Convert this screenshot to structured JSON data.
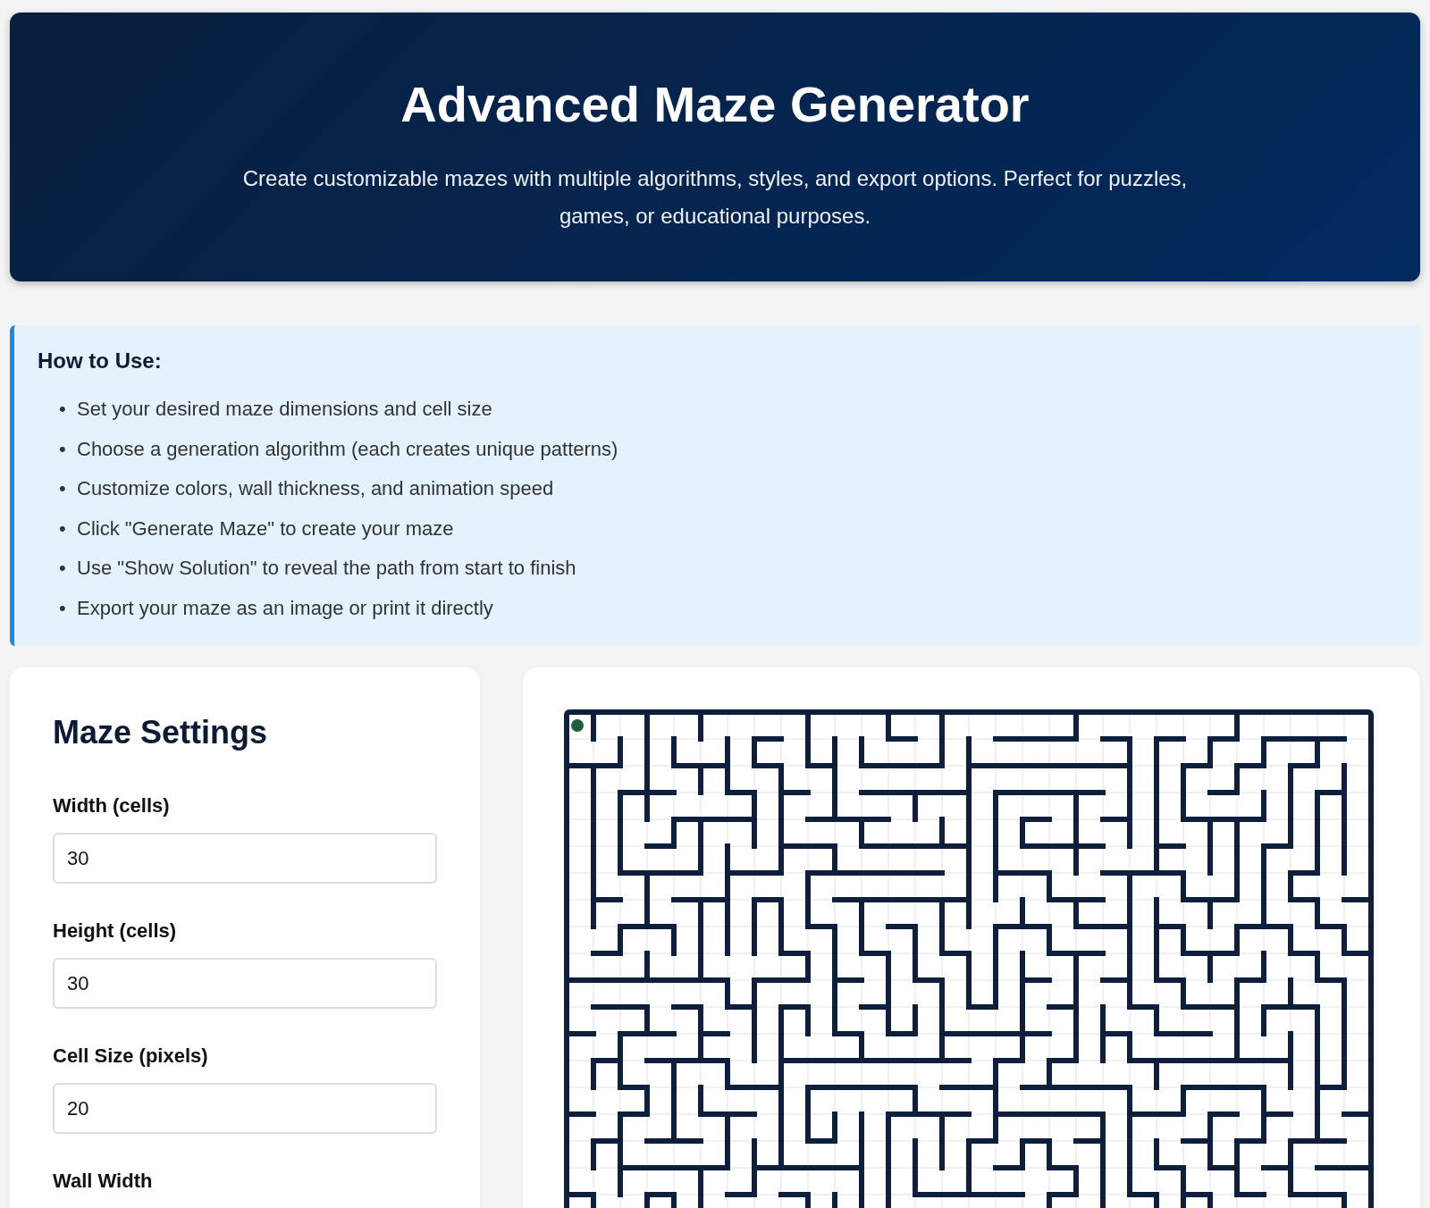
{
  "header": {
    "title": "Advanced Maze Generator",
    "subtitle": "Create customizable mazes with multiple algorithms, styles, and export options. Perfect for puzzles, games, or educational purposes."
  },
  "instructions": {
    "heading": "How to Use:",
    "items": [
      {
        "marker": "•",
        "text": "Set your desired maze dimensions and cell size"
      },
      {
        "marker": "•",
        "text": "Choose a generation algorithm (each creates unique patterns)"
      },
      {
        "marker": "•",
        "text": "Customize colors, wall thickness, and animation speed"
      },
      {
        "marker": "•",
        "text": "Click \"Generate Maze\" to create your maze"
      },
      {
        "marker": "•",
        "text": "Use \"Show Solution\" to reveal the path from start to finish"
      },
      {
        "marker": "•",
        "text": "Export your maze as an image or print it directly"
      }
    ]
  },
  "settings": {
    "title": "Maze Settings",
    "fields": [
      {
        "label": "Width (cells)",
        "value": "30"
      },
      {
        "label": "Height (cells)",
        "value": "30"
      },
      {
        "label": "Cell Size (pixels)",
        "value": "20"
      },
      {
        "label": "Wall Width"
      }
    ]
  }
}
